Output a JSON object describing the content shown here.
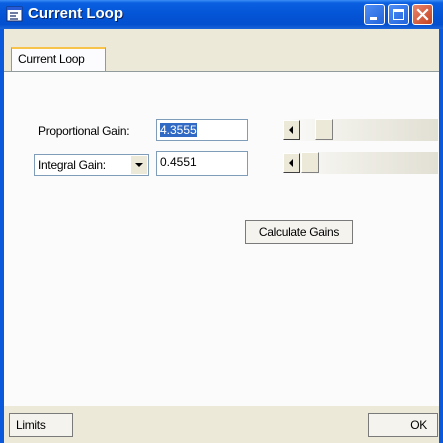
{
  "window": {
    "title": "Current Loop",
    "icon": "app-window-icon",
    "controls": [
      "minimize-icon",
      "maximize-icon",
      "close-icon"
    ]
  },
  "tabs": [
    {
      "label": "Current Loop",
      "active": true
    }
  ],
  "proportional_gain": {
    "label": "Proportional Gain:",
    "value": "4.3555"
  },
  "integral_gain": {
    "selected": "Integral Gain:",
    "value": "0.4551"
  },
  "buttons": {
    "calculate": "Calculate Gains",
    "limits": "Limits",
    "ok": "OK"
  },
  "colors": {
    "titlebar": "#0454d6",
    "selection": "#316ac5",
    "close": "#c5421f"
  }
}
